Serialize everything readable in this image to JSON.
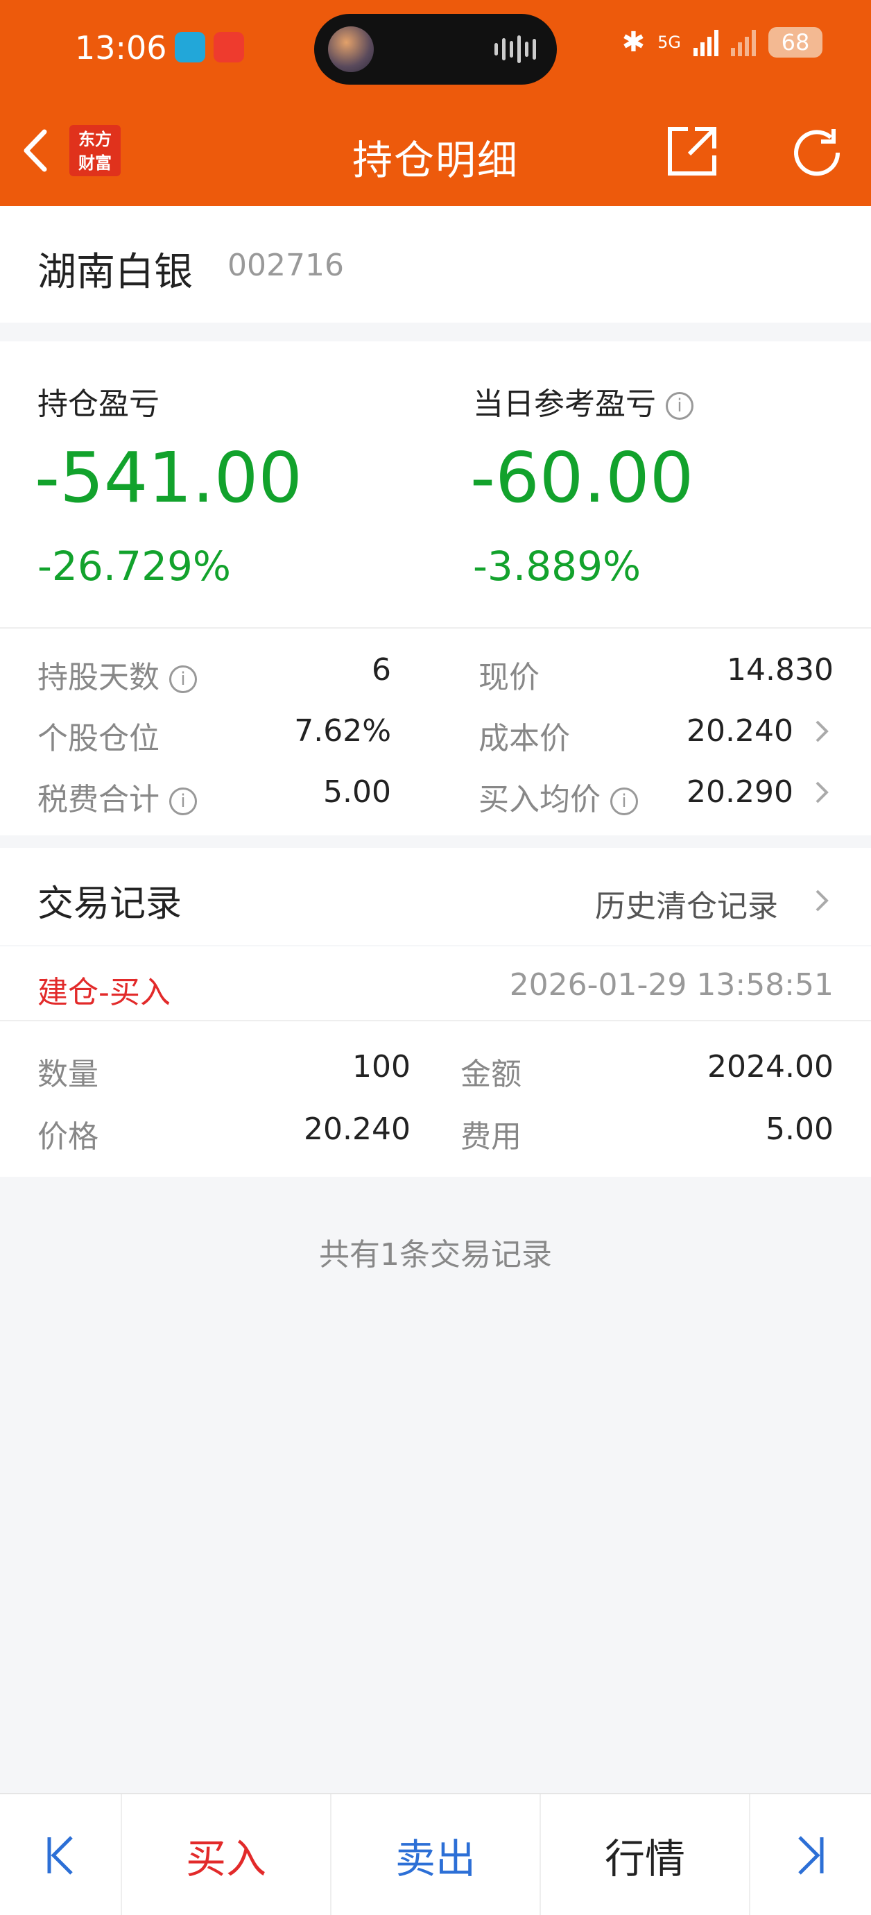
{
  "status_bar": {
    "time": "13:06",
    "network": "5G",
    "battery": "68"
  },
  "nav": {
    "title": "持仓明细",
    "logo_line1": "东方",
    "logo_line2": "财富"
  },
  "stock": {
    "name": "湖南白银",
    "code": "002716"
  },
  "pnl": {
    "holding_label": "持仓盈亏",
    "holding_value": "-541.00",
    "holding_pct": "-26.729%",
    "daily_label": "当日参考盈亏",
    "daily_value": "-60.00",
    "daily_pct": "-3.889%"
  },
  "stats": {
    "days_label": "持股天数",
    "days_value": "6",
    "position_label": "个股仓位",
    "position_value": "7.62%",
    "fees_label": "税费合计",
    "fees_value": "5.00",
    "price_label": "现价",
    "price_value": "14.830",
    "cost_label": "成本价",
    "cost_value": "20.240",
    "avg_label": "买入均价",
    "avg_value": "20.290"
  },
  "trades": {
    "title": "交易记录",
    "history_link": "历史清仓记录",
    "records": [
      {
        "type": "建仓-买入",
        "time": "2026-01-29 13:58:51",
        "qty_label": "数量",
        "qty": "100",
        "amount_label": "金额",
        "amount": "2024.00",
        "price_label": "价格",
        "price": "20.240",
        "fee_label": "费用",
        "fee": "5.00"
      }
    ],
    "total_note": "共有1条交易记录"
  },
  "bottom_bar": {
    "buy": "买入",
    "sell": "卖出",
    "market": "行情"
  },
  "colors": {
    "brand": "#ed5a0c",
    "loss": "#12a22c",
    "buy": "#e22a2a",
    "sell": "#2c6fd6"
  }
}
